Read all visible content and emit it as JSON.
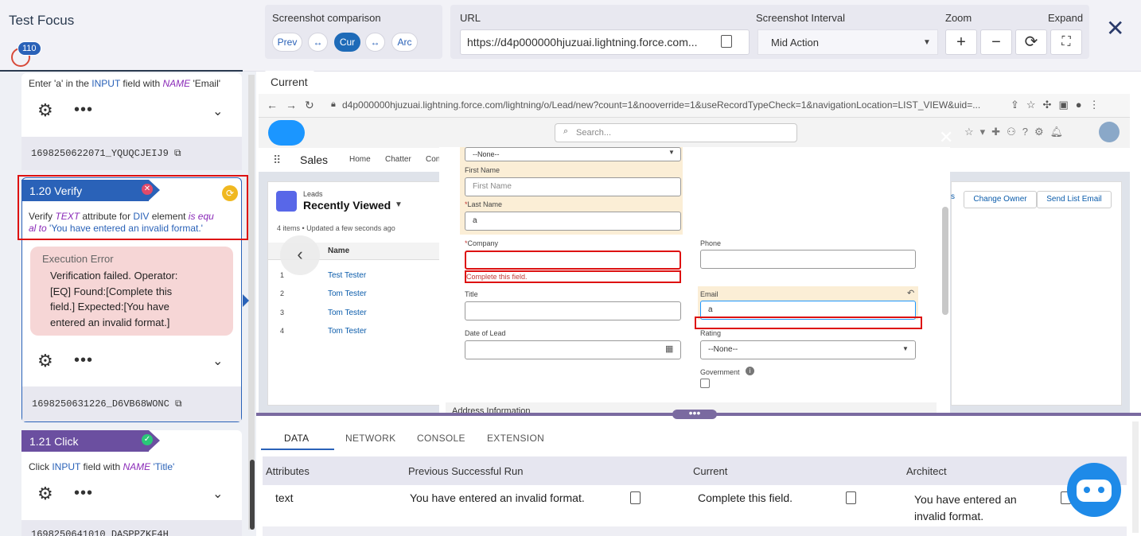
{
  "app": {
    "title": "Test Focus",
    "badge": "110"
  },
  "comparison": {
    "title": "Screenshot comparison",
    "prev": "Prev",
    "swap": "↔",
    "cur": "Cur",
    "arc": "Arc"
  },
  "url": {
    "title": "URL",
    "value": "https://d4p000000hjuzuai.lightning.force.com..."
  },
  "interval": {
    "title": "Screenshot Interval",
    "value": "Mid Action"
  },
  "zoom": {
    "title": "Zoom",
    "in": "+",
    "out": "−",
    "reset": "⟳"
  },
  "expand": {
    "title": "Expand",
    "icon": "⛶"
  },
  "steps": [
    {
      "text_pre": "Enter 'a' in the ",
      "kw1": "INPUT",
      "text_mid": " field with ",
      "kw2": "NAME",
      "text_post": " 'Email'",
      "id": "1698250622071_YQUQCJEIJ9"
    },
    {
      "label": "1.20 Verify",
      "line1_a": "Verify ",
      "line1_b": "TEXT",
      "line1_c": " attribute for ",
      "line1_d": "DIV",
      "line1_e": " element ",
      "line1_f": "is equ",
      "line2_a": "al to",
      "line2_b": " 'You have entered an invalid format.'",
      "error_title": "Execution Error",
      "error_lines": [
        "Verification failed. Operator:",
        "[EQ] Found:[Complete this",
        "field.] Expected:[You have",
        "entered an invalid format.]"
      ],
      "id": "1698250631226_D6VB68WONC"
    },
    {
      "label": "1.21 Click",
      "text_a": "Click ",
      "text_b": "INPUT",
      "text_c": " field with ",
      "text_d": "NAME",
      "text_e": " 'Title'",
      "id": "1698250641010_DASPPZKF4H"
    }
  ],
  "current_tab": "Current",
  "browser": {
    "url": "d4p000000hjuzuai.lightning.force.com/lightning/o/Lead/new?count=1&nooverride=1&useRecordTypeCheck=1&navigationLocation=LIST_VIEW&uid=...",
    "search": "Search...",
    "app_name": "Sales",
    "nav": [
      "Home",
      "Chatter",
      "Con"
    ],
    "list_obj": "Leads",
    "list_view": "Recently Viewed",
    "list_meta": "4 items • Updated a few seconds ago",
    "col_name": "Name",
    "rows": [
      {
        "n": "1",
        "name": "Test Tester"
      },
      {
        "n": "2",
        "name": "Tom Tester"
      },
      {
        "n": "3",
        "name": "Tom Tester"
      },
      {
        "n": "4",
        "name": "Tom Tester"
      }
    ],
    "buttons": {
      "change_owner": "Change Owner",
      "send_list_email": "Send List Email",
      "s": "s"
    }
  },
  "form": {
    "salutation": "--None--",
    "first_name_label": "First Name",
    "first_name_ph": "First Name",
    "last_name_label": "Last Name",
    "last_name_value": "a",
    "company_label": "Company",
    "company_error": "Complete this field.",
    "phone_label": "Phone",
    "title_label": "Title",
    "email_label": "Email",
    "email_value": "a",
    "date_label": "Date of Lead",
    "rating_label": "Rating",
    "rating_value": "--None--",
    "government_label": "Government",
    "address_label": "Address Information",
    "required_mark": "*"
  },
  "bottom_tabs": [
    "DATA",
    "NETWORK",
    "CONSOLE",
    "EXTENSION"
  ],
  "table": {
    "headers": [
      "Attributes",
      "Previous Successful Run",
      "Current",
      "Architect"
    ],
    "rows": [
      {
        "attr": "text",
        "prev": "You have entered an invalid format.",
        "cur": "Complete this field.",
        "arch_1": "You have entered an",
        "arch_2": "invalid format."
      }
    ]
  },
  "colors": {
    "accent": "#1e6bb8",
    "error": "#dd1111",
    "verify": "#2a62b8",
    "click": "#6b4fa0"
  }
}
